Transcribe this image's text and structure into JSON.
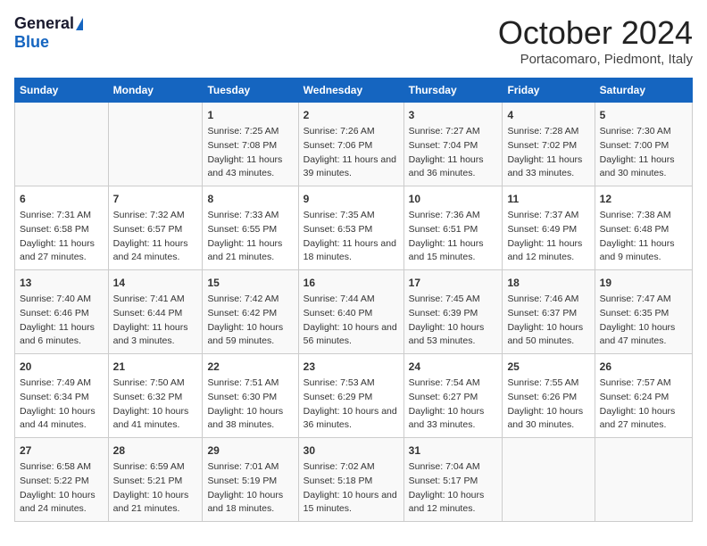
{
  "logo": {
    "general": "General",
    "blue": "Blue"
  },
  "title": "October 2024",
  "location": "Portacomaro, Piedmont, Italy",
  "days_of_week": [
    "Sunday",
    "Monday",
    "Tuesday",
    "Wednesday",
    "Thursday",
    "Friday",
    "Saturday"
  ],
  "weeks": [
    [
      {
        "day": "",
        "content": ""
      },
      {
        "day": "",
        "content": ""
      },
      {
        "day": "1",
        "content": "Sunrise: 7:25 AM\nSunset: 7:08 PM\nDaylight: 11 hours and 43 minutes."
      },
      {
        "day": "2",
        "content": "Sunrise: 7:26 AM\nSunset: 7:06 PM\nDaylight: 11 hours and 39 minutes."
      },
      {
        "day": "3",
        "content": "Sunrise: 7:27 AM\nSunset: 7:04 PM\nDaylight: 11 hours and 36 minutes."
      },
      {
        "day": "4",
        "content": "Sunrise: 7:28 AM\nSunset: 7:02 PM\nDaylight: 11 hours and 33 minutes."
      },
      {
        "day": "5",
        "content": "Sunrise: 7:30 AM\nSunset: 7:00 PM\nDaylight: 11 hours and 30 minutes."
      }
    ],
    [
      {
        "day": "6",
        "content": "Sunrise: 7:31 AM\nSunset: 6:58 PM\nDaylight: 11 hours and 27 minutes."
      },
      {
        "day": "7",
        "content": "Sunrise: 7:32 AM\nSunset: 6:57 PM\nDaylight: 11 hours and 24 minutes."
      },
      {
        "day": "8",
        "content": "Sunrise: 7:33 AM\nSunset: 6:55 PM\nDaylight: 11 hours and 21 minutes."
      },
      {
        "day": "9",
        "content": "Sunrise: 7:35 AM\nSunset: 6:53 PM\nDaylight: 11 hours and 18 minutes."
      },
      {
        "day": "10",
        "content": "Sunrise: 7:36 AM\nSunset: 6:51 PM\nDaylight: 11 hours and 15 minutes."
      },
      {
        "day": "11",
        "content": "Sunrise: 7:37 AM\nSunset: 6:49 PM\nDaylight: 11 hours and 12 minutes."
      },
      {
        "day": "12",
        "content": "Sunrise: 7:38 AM\nSunset: 6:48 PM\nDaylight: 11 hours and 9 minutes."
      }
    ],
    [
      {
        "day": "13",
        "content": "Sunrise: 7:40 AM\nSunset: 6:46 PM\nDaylight: 11 hours and 6 minutes."
      },
      {
        "day": "14",
        "content": "Sunrise: 7:41 AM\nSunset: 6:44 PM\nDaylight: 11 hours and 3 minutes."
      },
      {
        "day": "15",
        "content": "Sunrise: 7:42 AM\nSunset: 6:42 PM\nDaylight: 10 hours and 59 minutes."
      },
      {
        "day": "16",
        "content": "Sunrise: 7:44 AM\nSunset: 6:40 PM\nDaylight: 10 hours and 56 minutes."
      },
      {
        "day": "17",
        "content": "Sunrise: 7:45 AM\nSunset: 6:39 PM\nDaylight: 10 hours and 53 minutes."
      },
      {
        "day": "18",
        "content": "Sunrise: 7:46 AM\nSunset: 6:37 PM\nDaylight: 10 hours and 50 minutes."
      },
      {
        "day": "19",
        "content": "Sunrise: 7:47 AM\nSunset: 6:35 PM\nDaylight: 10 hours and 47 minutes."
      }
    ],
    [
      {
        "day": "20",
        "content": "Sunrise: 7:49 AM\nSunset: 6:34 PM\nDaylight: 10 hours and 44 minutes."
      },
      {
        "day": "21",
        "content": "Sunrise: 7:50 AM\nSunset: 6:32 PM\nDaylight: 10 hours and 41 minutes."
      },
      {
        "day": "22",
        "content": "Sunrise: 7:51 AM\nSunset: 6:30 PM\nDaylight: 10 hours and 38 minutes."
      },
      {
        "day": "23",
        "content": "Sunrise: 7:53 AM\nSunset: 6:29 PM\nDaylight: 10 hours and 36 minutes."
      },
      {
        "day": "24",
        "content": "Sunrise: 7:54 AM\nSunset: 6:27 PM\nDaylight: 10 hours and 33 minutes."
      },
      {
        "day": "25",
        "content": "Sunrise: 7:55 AM\nSunset: 6:26 PM\nDaylight: 10 hours and 30 minutes."
      },
      {
        "day": "26",
        "content": "Sunrise: 7:57 AM\nSunset: 6:24 PM\nDaylight: 10 hours and 27 minutes."
      }
    ],
    [
      {
        "day": "27",
        "content": "Sunrise: 6:58 AM\nSunset: 5:22 PM\nDaylight: 10 hours and 24 minutes."
      },
      {
        "day": "28",
        "content": "Sunrise: 6:59 AM\nSunset: 5:21 PM\nDaylight: 10 hours and 21 minutes."
      },
      {
        "day": "29",
        "content": "Sunrise: 7:01 AM\nSunset: 5:19 PM\nDaylight: 10 hours and 18 minutes."
      },
      {
        "day": "30",
        "content": "Sunrise: 7:02 AM\nSunset: 5:18 PM\nDaylight: 10 hours and 15 minutes."
      },
      {
        "day": "31",
        "content": "Sunrise: 7:04 AM\nSunset: 5:17 PM\nDaylight: 10 hours and 12 minutes."
      },
      {
        "day": "",
        "content": ""
      },
      {
        "day": "",
        "content": ""
      }
    ]
  ]
}
